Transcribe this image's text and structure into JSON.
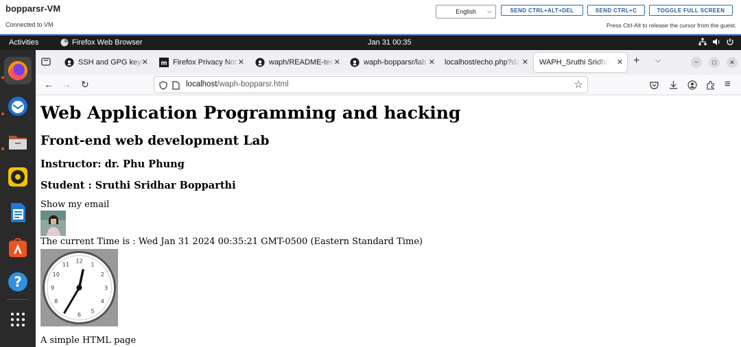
{
  "vm": {
    "title": "bopparsr-VM",
    "status": "Connected to VM",
    "language": "English",
    "buttons": [
      "SEND CTRL+ALT+DEL",
      "SEND CTRL+C",
      "TOGGLE FULL SCREEN"
    ],
    "hint": "Press Ctrl-Alt to release the cursor from the guest."
  },
  "topbar": {
    "activities": "Activities",
    "app": "Firefox Web Browser",
    "clock": "Jan 31  00:35"
  },
  "dock": [
    "firefox-icon",
    "thunderbird-icon",
    "files-icon",
    "rhythmbox-icon",
    "writer-icon",
    "app-center-icon",
    "help-icon",
    "show-apps-icon"
  ],
  "tabs": [
    {
      "title": "SSH and GPG keys",
      "icon": "github-icon"
    },
    {
      "title": "Firefox Privacy Not",
      "icon": "mdn-icon"
    },
    {
      "title": "waph/README-ten",
      "icon": "github-icon"
    },
    {
      "title": "waph-bopparsr/lab",
      "icon": "github-icon"
    },
    {
      "title": "localhost/echo.php?da",
      "icon": ""
    },
    {
      "title": "WAPH_Sruthi Sridhar",
      "icon": ""
    }
  ],
  "url": {
    "host": "localhost",
    "path": "/waph-bopparsr.html"
  },
  "page": {
    "h1": "Web Application Programming and hacking",
    "h2": "Front-end web development Lab",
    "instructor": "Instructor: dr. Phu Phung",
    "student": "Student : Sruthi Sridhar Bopparthi",
    "email_link": "Show my email",
    "time_line": "The current Time is : Wed Jan 31 2024 00:35:21 GMT-0500 (Eastern Standard Time)",
    "simple": "A simple HTML page",
    "clock_numbers": [
      "12",
      "1",
      "2",
      "3",
      "4",
      "5",
      "6",
      "7",
      "8",
      "9",
      "10",
      "11"
    ]
  },
  "colors": {
    "accent": "#2f6fd6",
    "ubuntu_orange": "#e95420"
  }
}
